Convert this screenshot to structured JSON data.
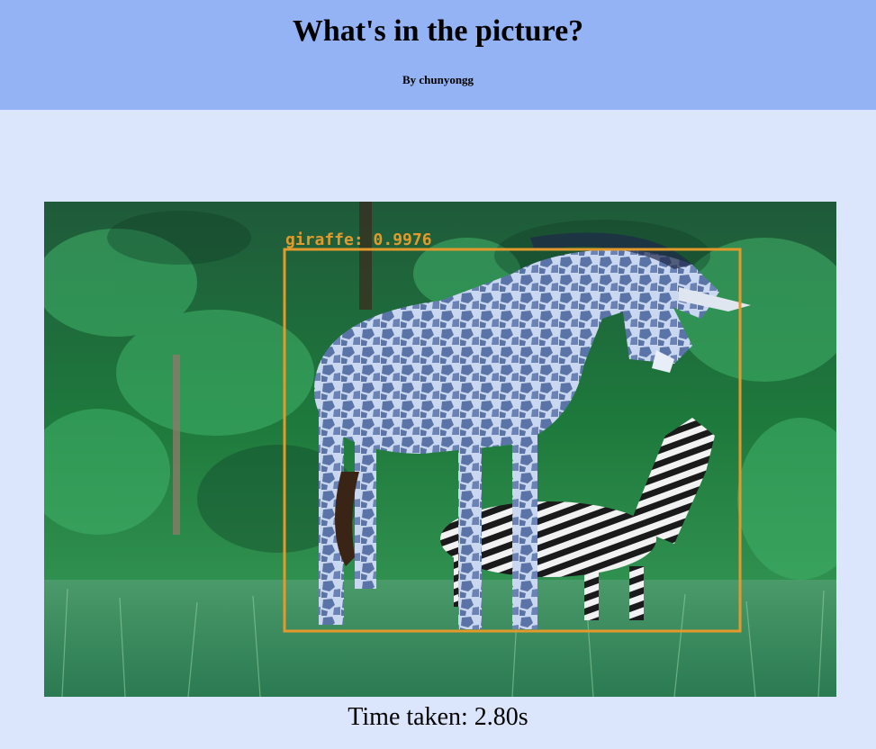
{
  "header": {
    "title": "What's in the picture?",
    "byline": "By chunyongg"
  },
  "image": {
    "detection_label": "giraffe: 0.9976",
    "box_color": "#e39a2d",
    "description_icon": "detection-photo"
  },
  "footer": {
    "time_taken": "Time taken: 2.80s"
  }
}
